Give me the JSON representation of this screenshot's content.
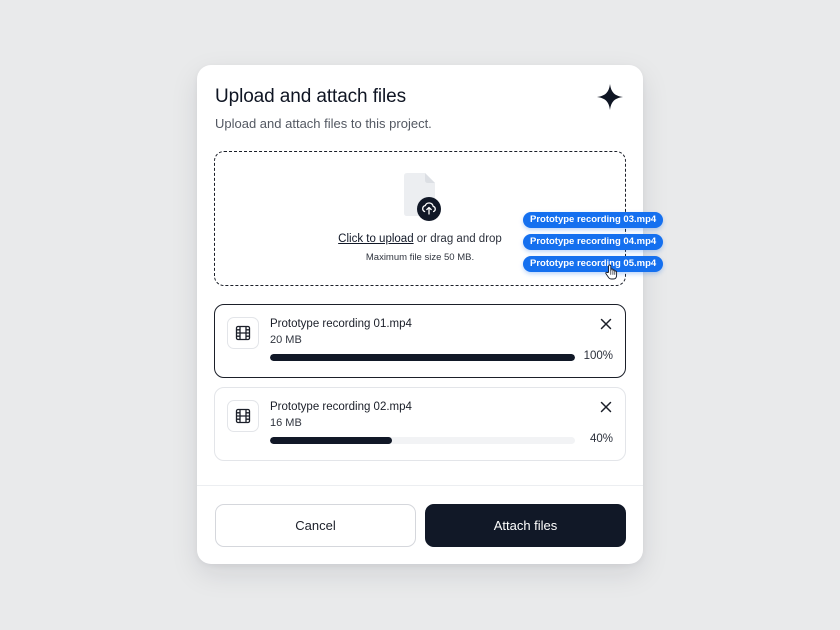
{
  "dialog": {
    "title": "Upload and attach files",
    "subtitle": "Upload and attach files to this project."
  },
  "dropzone": {
    "link_text": "Click to upload",
    "rest_text": " or drag and drop",
    "hint": "Maximum file size 50 MB."
  },
  "dragged_files": [
    "Prototype recording 03.mp4",
    "Prototype recording 04.mp4",
    "Prototype recording 05.mp4"
  ],
  "files": [
    {
      "name": "Prototype recording 01.mp4",
      "size": "20 MB",
      "progress_label": "100%",
      "progress": 1.0,
      "active": true
    },
    {
      "name": "Prototype recording 02.mp4",
      "size": "16 MB",
      "progress_label": "40%",
      "progress": 0.4,
      "active": false
    }
  ],
  "footer": {
    "cancel_label": "Cancel",
    "attach_label": "Attach files"
  },
  "colors": {
    "accent": "#1570ef",
    "primary": "#111827",
    "background": "#e9eaeb"
  },
  "icons": {
    "header": "sparkle-icon",
    "upload": "file-upload-icon",
    "file": "film-icon",
    "remove": "close-icon",
    "cursor": "hand-pointer-icon"
  }
}
